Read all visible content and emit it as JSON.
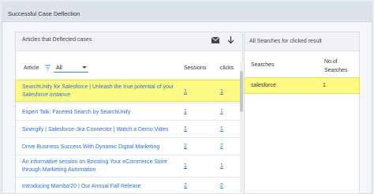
{
  "section": {
    "title": "Successful Case Deflection"
  },
  "left_panel": {
    "title": "Articles that Deflected cases",
    "columns": {
      "article": "Article",
      "sessions": "Sessions",
      "clicks": "clicks"
    },
    "filter": {
      "selected": "All"
    },
    "rows": [
      {
        "title": "SearchUnify for Salesforce | Unleash the true potential of your Salesforce instance",
        "sessions": "1",
        "clicks": "1",
        "highlighted": true
      },
      {
        "title": "Expert Talk: Faceted Search by SearchUnify",
        "sessions": "1",
        "clicks": "1"
      },
      {
        "title": "Sinergify | Salesforce-Jira Connector | Watch a Demo Video",
        "sessions": "1",
        "clicks": "1"
      },
      {
        "title": "Drive Business Success With Dynamic Digital Marketing",
        "sessions": "2",
        "clicks": "2"
      },
      {
        "title": "An informative session on Boosting Your eCommerce Store through Marketing Automation",
        "sessions": "1",
        "clicks": "1"
      },
      {
        "title": "Introducing Mamba'20 | Our Annual Fall Release",
        "sessions": "2",
        "clicks": "2"
      }
    ]
  },
  "right_panel": {
    "title": "All Searches for clicked result",
    "columns": {
      "searches": "Searches",
      "count_line1": "No.of",
      "count_line2": "Searches"
    },
    "rows": [
      {
        "term": "salesforce",
        "count": "1"
      }
    ]
  },
  "colors": {
    "highlight": "#fdfb83",
    "link": "#2a6fd6",
    "accent": "#2f80ed"
  }
}
